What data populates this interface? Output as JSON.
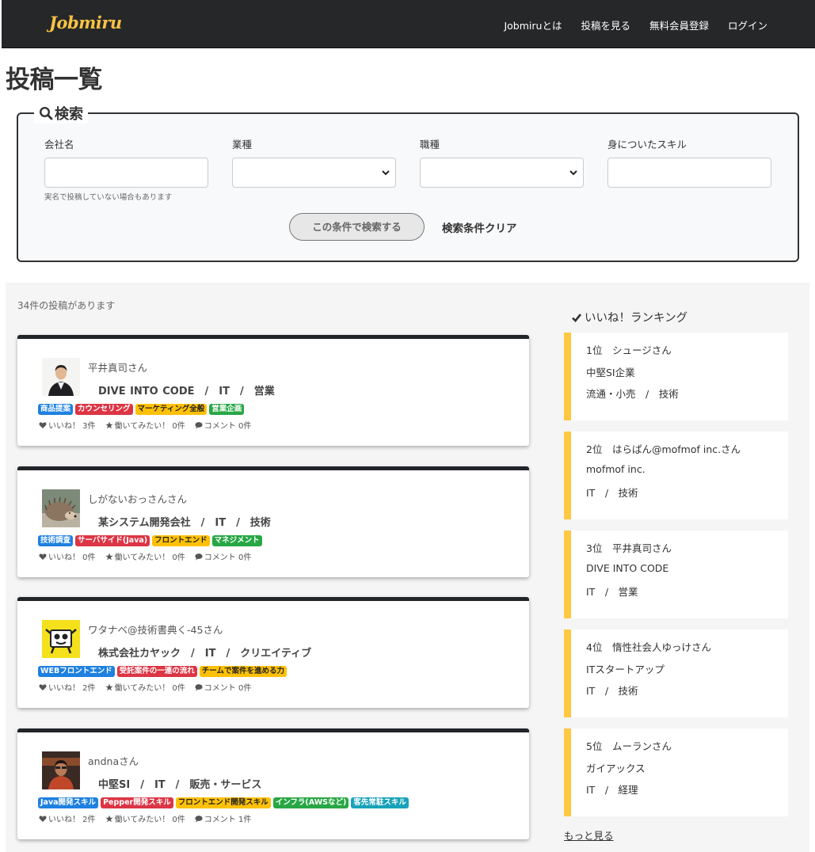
{
  "navbar": {
    "brand": "Jobmiru",
    "links": [
      "Jobmiruとは",
      "投稿を見る",
      "無料会員登録",
      "ログイン"
    ]
  },
  "page_title": "投稿一覧",
  "search": {
    "legend": "検索",
    "company_label": "会社名",
    "company_value": "",
    "company_note": "実名で投稿していない場合もあります",
    "industry_label": "業種",
    "industry_selected": "",
    "job_label": "職種",
    "job_selected": "",
    "skill_label": "身についたスキル",
    "skill_value": "",
    "submit_label": "この条件で検索する",
    "clear_label": "検索条件クリア"
  },
  "post_count": "34件の投稿があります",
  "posts": [
    {
      "author": "平井真司さん",
      "company_line": "DIVE INTO CODE　/　IT　/　営業",
      "tags": [
        {
          "label": "商品提案",
          "color": "blue"
        },
        {
          "label": "カウンセリング",
          "color": "red"
        },
        {
          "label": "マーケティング全般",
          "color": "yellow"
        },
        {
          "label": "営業企画",
          "color": "green"
        }
      ],
      "likes": "いいね！ 3件",
      "want": "働いてみたい！ 0件",
      "comments": "コメント 0件"
    },
    {
      "author": "しがないおっさんさん",
      "company_line": "某システム開発会社　/　IT　/　技術",
      "tags": [
        {
          "label": "技術調査",
          "color": "blue"
        },
        {
          "label": "サーバサイド(Java)",
          "color": "red"
        },
        {
          "label": "フロントエンド",
          "color": "yellow"
        },
        {
          "label": "マネジメント",
          "color": "green"
        }
      ],
      "likes": "いいね！ 0件",
      "want": "働いてみたい！ 0件",
      "comments": "コメント 0件"
    },
    {
      "author": "ワタナベ@技術書典く-45さん",
      "company_line": "株式会社カヤック　/　IT　/　クリエイティブ",
      "tags": [
        {
          "label": "WEBフロントエンド",
          "color": "blue"
        },
        {
          "label": "受託案件の一連の流れ",
          "color": "red"
        },
        {
          "label": "チームで案件を進める力",
          "color": "yellow"
        }
      ],
      "likes": "いいね！ 2件",
      "want": "働いてみたい！ 0件",
      "comments": "コメント 0件"
    },
    {
      "author": "andnaさん",
      "company_line": "中堅SI　/　IT　/　販売・サービス",
      "tags": [
        {
          "label": "Java開発スキル",
          "color": "blue"
        },
        {
          "label": "Pepper開発スキル",
          "color": "red"
        },
        {
          "label": "フロントエンド開発スキル",
          "color": "yellow"
        },
        {
          "label": "インフラ(AWSなど)",
          "color": "green"
        },
        {
          "label": "客先常駐スキル",
          "color": "teal"
        }
      ],
      "likes": "いいね！ 2件",
      "want": "働いてみたい！ 0件",
      "comments": "コメント 1件"
    }
  ],
  "ranking": {
    "title": "いいね！ランキング",
    "items": [
      {
        "rank_name": "1位　シュージさん",
        "company": "中堅SI企業",
        "category": "流通・小売　/　技術"
      },
      {
        "rank_name": "2位　はらぱん@mofmof inc.さん",
        "company": "mofmof inc.",
        "category": "IT　/　技術"
      },
      {
        "rank_name": "3位　平井真司さん",
        "company": "DIVE INTO CODE",
        "category": "IT　/　営業"
      },
      {
        "rank_name": "4位　惰性社会人ゆっけさん",
        "company": "ITスタートアップ",
        "category": "IT　/　技術"
      },
      {
        "rank_name": "5位　ムーランさん",
        "company": "ガイアックス",
        "category": "IT　/　経理"
      }
    ],
    "more_label": "もっと見る"
  },
  "colors": {
    "navbar": "#262729",
    "brand": "#f6c343",
    "rank_accent": "#ffc843",
    "card_top": "#212529"
  }
}
